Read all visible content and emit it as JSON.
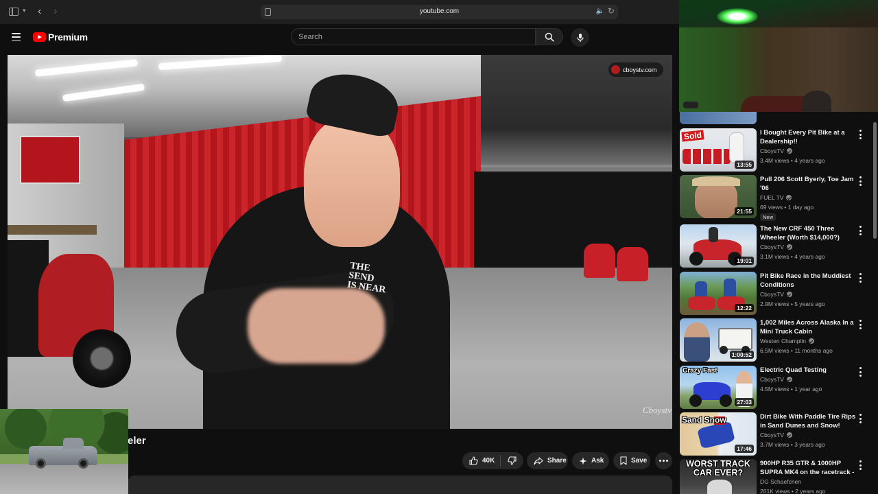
{
  "browser": {
    "url": "youtube.com"
  },
  "header": {
    "logo_text": "Premium",
    "search_placeholder": "Search"
  },
  "video": {
    "channel_badge": "cboystv.com",
    "watermark": "Cboystv",
    "shirt_print": [
      "THE SEND",
      "IS NEAR"
    ],
    "title_fragment": "eler"
  },
  "actions": {
    "likes": "40K",
    "share": "Share",
    "ask": "Ask",
    "save": "Save"
  },
  "recommendations": [
    {
      "title": "I Bought Every Pit Bike at a Dealership!!",
      "channel": "CboysTV",
      "verified": true,
      "meta": "3.4M views • 4 years ago",
      "duration": "13:55",
      "thumb_text": "Sold",
      "badge": ""
    },
    {
      "title": "Pull 206   Scott Byerly, Toe Jam '06",
      "channel": "FUEL TV",
      "verified": true,
      "meta": "69 views • 1 day ago",
      "duration": "21:55",
      "thumb_text": "",
      "badge": "New"
    },
    {
      "title": "The New CRF 450 Three Wheeler (Worth $14,000?)",
      "channel": "CboysTV",
      "verified": true,
      "meta": "3.1M views • 4 years ago",
      "duration": "19:01",
      "thumb_text": "",
      "badge": ""
    },
    {
      "title": "Pit Bike Race in the Muddiest Conditions",
      "channel": "CboysTV",
      "verified": true,
      "meta": "2.9M views • 5 years ago",
      "duration": "12:22",
      "thumb_text": "",
      "badge": ""
    },
    {
      "title": "1,002 Miles Across Alaska In a Mini Truck Cabin",
      "channel": "Westen Champlin",
      "verified": true,
      "meta": "6.5M views • 11 months ago",
      "duration": "1:00:52",
      "thumb_text": "",
      "badge": ""
    },
    {
      "title": "Electric Quad Testing",
      "channel": "CboysTV",
      "verified": true,
      "meta": "4.5M views • 1 year ago",
      "duration": "27:03",
      "thumb_text": "Crazy Fast",
      "badge": ""
    },
    {
      "title": "Dirt Bike With Paddle Tire Rips in Sand Dunes and Snow!",
      "channel": "CboysTV",
      "verified": true,
      "meta": "3.7M views • 3 years ago",
      "duration": "17:46",
      "thumb_text": "Sand    Snow",
      "badge": ""
    },
    {
      "title": "900HP R35 GTR & 1000HP SUPRA MK4 on the racetrack - ...",
      "channel": "DG Schaefchen",
      "verified": false,
      "meta": "261K views • 2 years ago",
      "duration": "",
      "thumb_text": "WORST TRACK CAR EVER?",
      "badge": ""
    }
  ],
  "colors": {
    "youtube_red": "#ff0000",
    "background": "#0f0f0f",
    "pill": "#272727",
    "audio_blue": "#4a8df8"
  },
  "icons": [
    "sidebar-toggle-icon",
    "chevron-down-icon",
    "back-arrow-icon",
    "forward-arrow-icon",
    "page-icon",
    "speaker-icon",
    "reload-icon",
    "menu-icon",
    "search-icon",
    "microphone-icon",
    "thumbs-up-icon",
    "thumbs-down-icon",
    "share-icon",
    "sparkle-icon",
    "bookmark-icon",
    "more-horizontal-icon",
    "more-vertical-icon",
    "verified-icon"
  ]
}
